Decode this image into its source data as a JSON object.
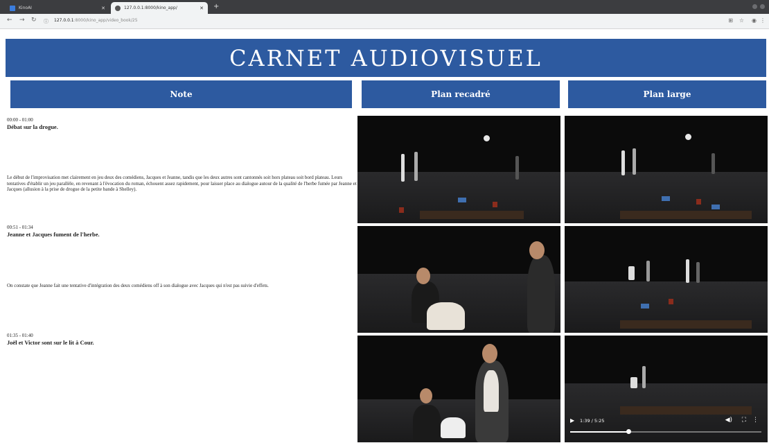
{
  "browser": {
    "tabs": [
      {
        "label": "KinoAI",
        "favicon_color": "#3b7ddd"
      },
      {
        "label": "127.0.0.1:8000/kino_app/",
        "favicon_color": "#555555"
      }
    ],
    "url_host": "127.0.0.1",
    "url_path": ":8000/kino_app/video_book/25"
  },
  "page": {
    "title": "CARNET AUDIOVISUEL",
    "columns": [
      "Note",
      "Plan recadré",
      "Plan large"
    ]
  },
  "notes": [
    {
      "time": "00:00 - 01:00",
      "title": "Débat sur la drogue.",
      "description": "Le début de l'improvisation met clairement en jeu deux des comédiens, Jacques et Jeanne, tandis que les deux autres sont cantonnés soit hors plateau soit bord plateau. Leurs tentatives d'établir un jeu parallèle, en revenant à l'évocation du roman, échouent assez rapidement, pour laisser place au dialogue autour de la qualité de l'herbe fumée par Jeanne et Jacques (allusion à la prise de drogue de la petite bande à Shelley)."
    },
    {
      "time": "00:51 - 01:34",
      "title": "Jeanne et Jacques fument de l'herbe.",
      "description": "On constate que Jeanne fait une tentative d'intégration des deux comédiens off à son dialogue avec Jacques qui n'est pas suivie d'effets."
    },
    {
      "time": "01:35 - 01:40",
      "title": "Joël et Victor sont sur le lit à Cour.",
      "description": ""
    }
  ],
  "video": {
    "time": "1:39 / 5:25",
    "progress": 0.305
  },
  "colors": {
    "brand_blue": "#2d5aa0"
  }
}
